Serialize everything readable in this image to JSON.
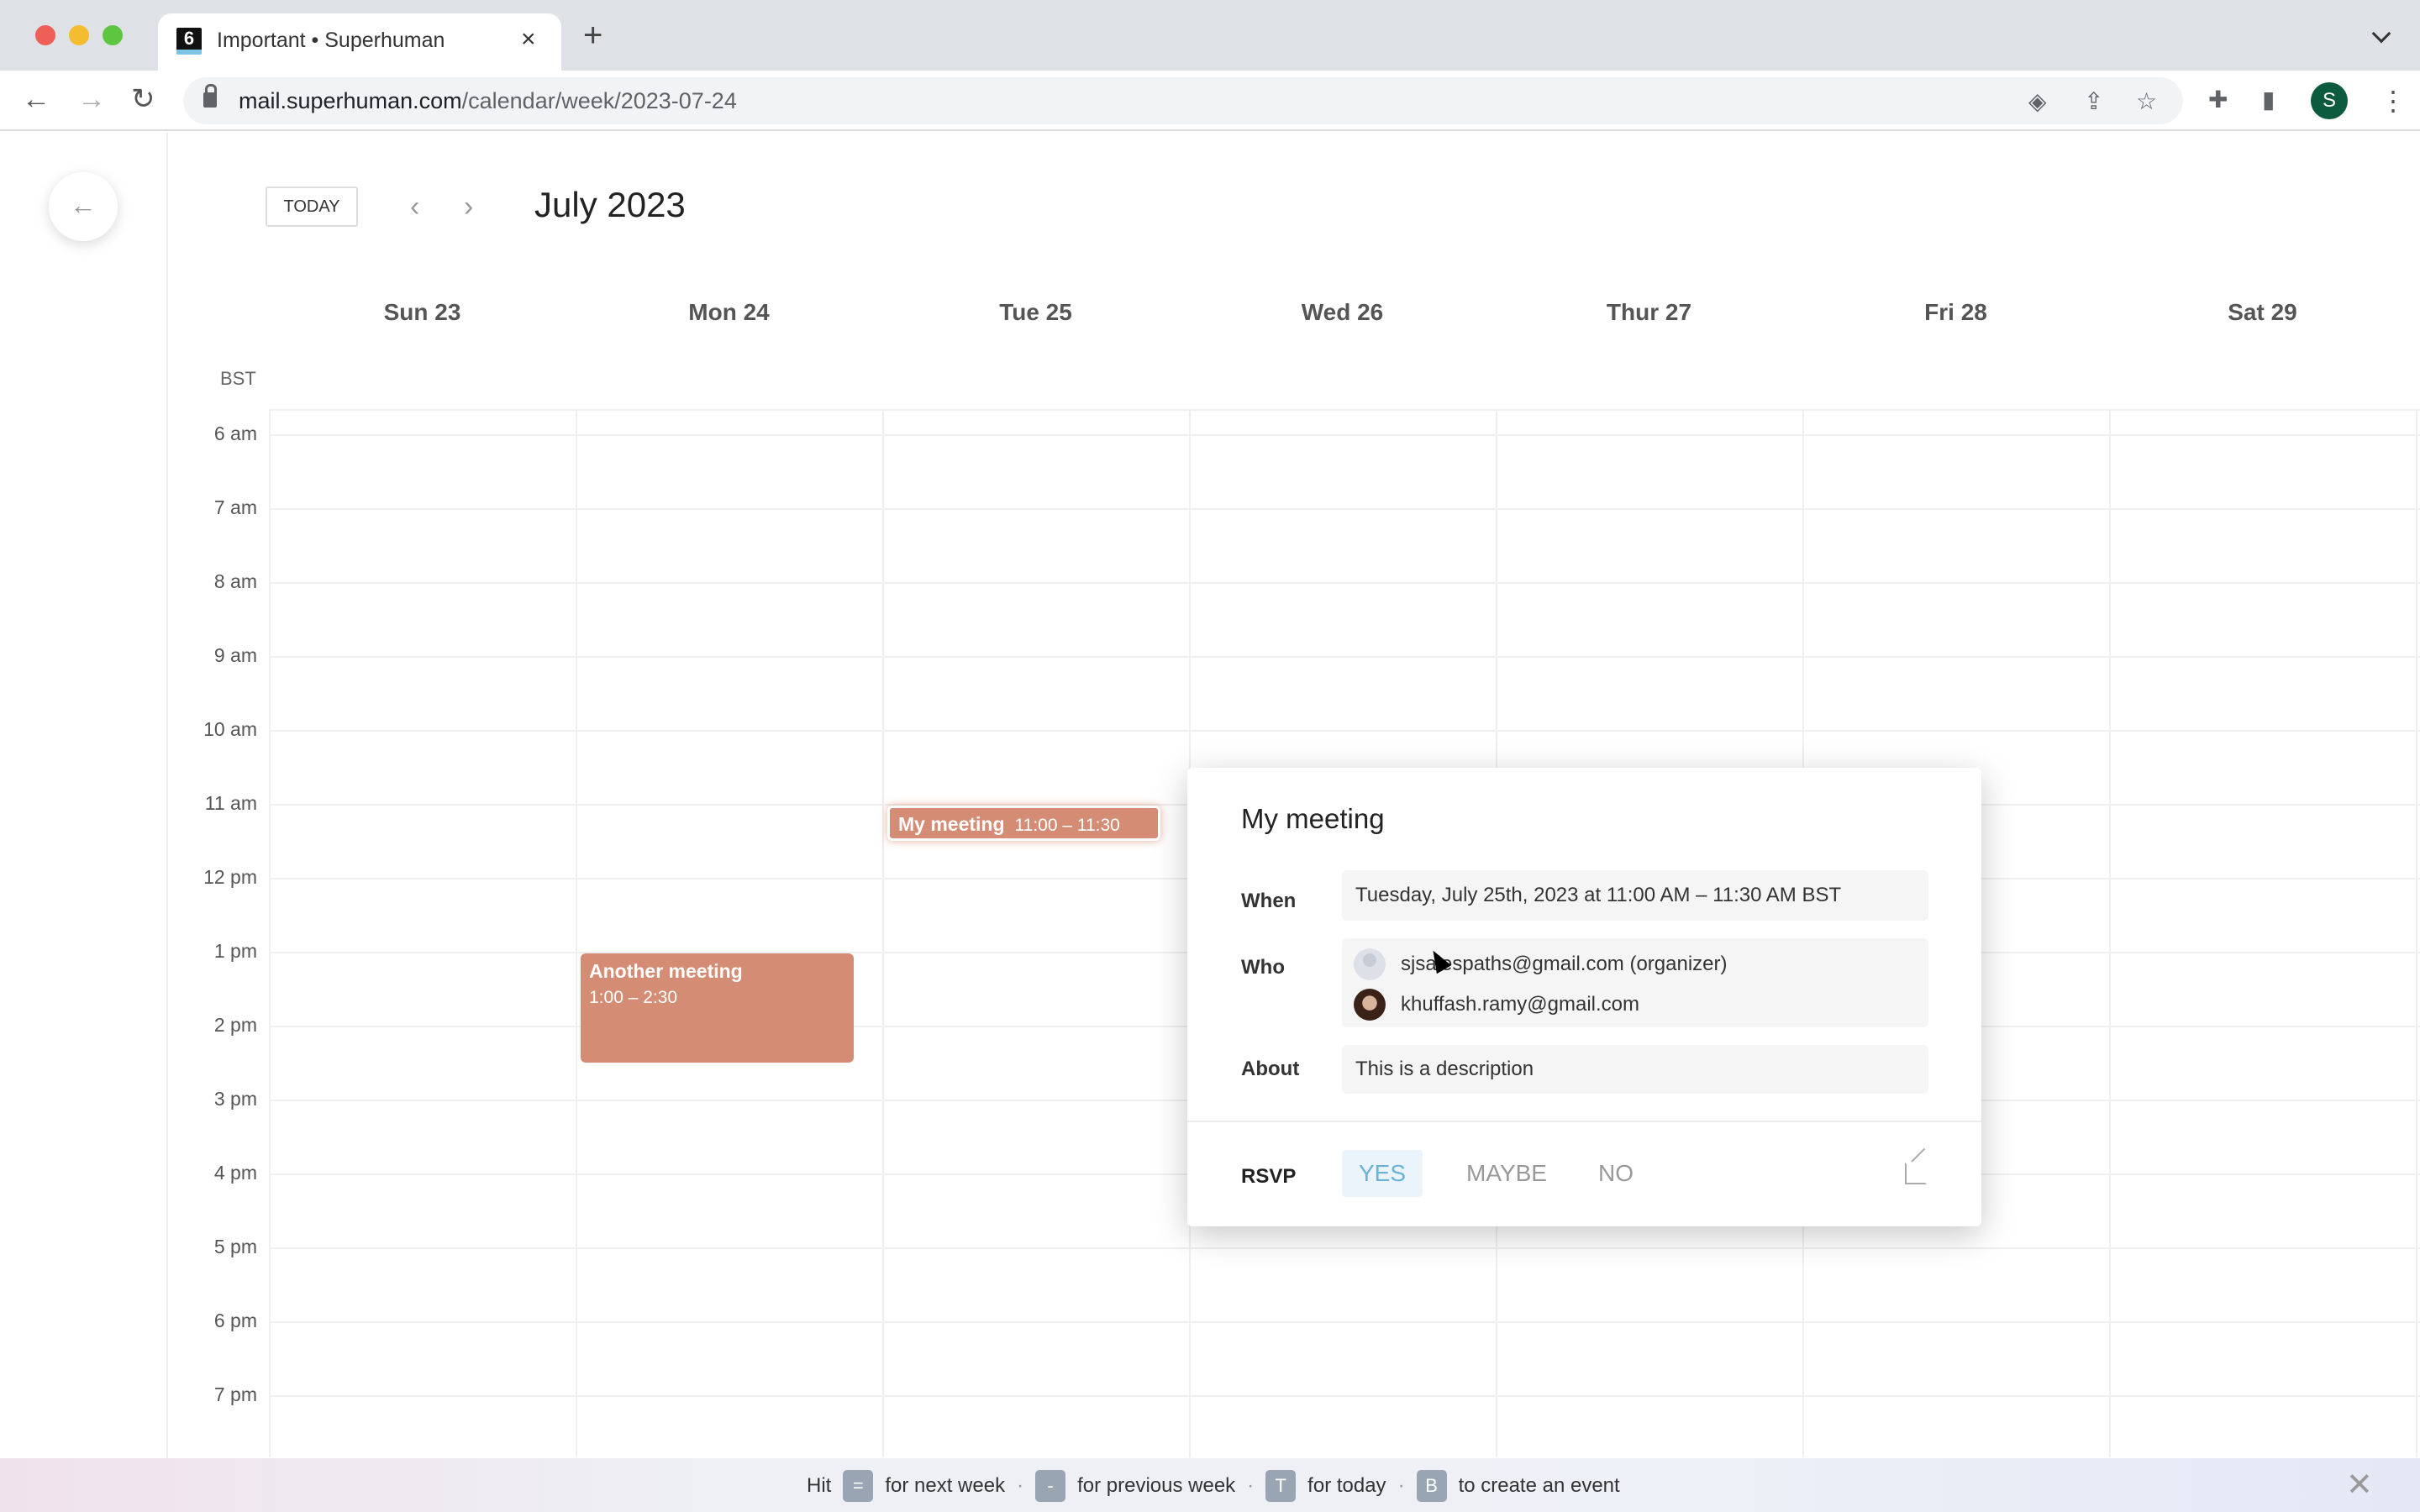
{
  "browser": {
    "tab_title": "Important • Superhuman",
    "tab_favicon_text": "6",
    "url_host": "mail.superhuman.com",
    "url_path": "/calendar/week/2023-07-24",
    "profile_initial": "S",
    "icons": {
      "back": "arrow-left-icon",
      "forward": "arrow-right-icon",
      "reload": "reload-icon",
      "lock": "lock-icon",
      "install": "install-app-icon",
      "share": "share-icon",
      "bookmark": "star-icon",
      "extensions": "puzzle-icon",
      "sidepanel": "side-panel-icon",
      "menu": "kebab-icon"
    }
  },
  "calendar": {
    "today_label": "TODAY",
    "month_title": "July 2023",
    "timezone": "BST",
    "days": [
      "Sun 23",
      "Mon 24",
      "Tue 25",
      "Wed 26",
      "Thur 27",
      "Fri 28",
      "Sat 29"
    ],
    "hours": [
      "6 am",
      "7 am",
      "8 am",
      "9 am",
      "10 am",
      "11 am",
      "12 pm",
      "1 pm",
      "2 pm",
      "3 pm",
      "4 pm",
      "5 pm",
      "6 pm",
      "7 pm"
    ],
    "first_hour": 6,
    "events": [
      {
        "title": "My meeting",
        "time": "11:00 – 11:30",
        "day_index": 2,
        "start_hour": 11.0,
        "end_hour": 11.5,
        "selected": true,
        "color": "#d48d74"
      },
      {
        "title": "Another meeting",
        "time": "1:00 – 2:30",
        "day_index": 1,
        "start_hour": 13.0,
        "end_hour": 14.5,
        "selected": false,
        "color": "#d48d74"
      }
    ]
  },
  "popup": {
    "title": "My meeting",
    "when_label": "When",
    "when_value": "Tuesday, July 25th, 2023 at 11:00 AM – 11:30 AM BST",
    "who_label": "Who",
    "attendees": [
      {
        "email": "sjsalespaths@gmail.com (organizer)",
        "avatar": "default-avatar"
      },
      {
        "email": "khuffash.ramy@gmail.com",
        "avatar": "photo-avatar"
      }
    ],
    "about_label": "About",
    "about_value": "This is a description",
    "rsvp_label": "RSVP",
    "rsvp_options": [
      "YES",
      "MAYBE",
      "NO"
    ],
    "rsvp_selected": "YES",
    "accent_color": "#6bb1d8"
  },
  "hint": {
    "prefix": "Hit",
    "items": [
      {
        "key": "=",
        "text": "for next week"
      },
      {
        "key": "-",
        "text": "for previous week"
      },
      {
        "key": "T",
        "text": "for today"
      },
      {
        "key": "B",
        "text": "to create an event"
      }
    ]
  }
}
